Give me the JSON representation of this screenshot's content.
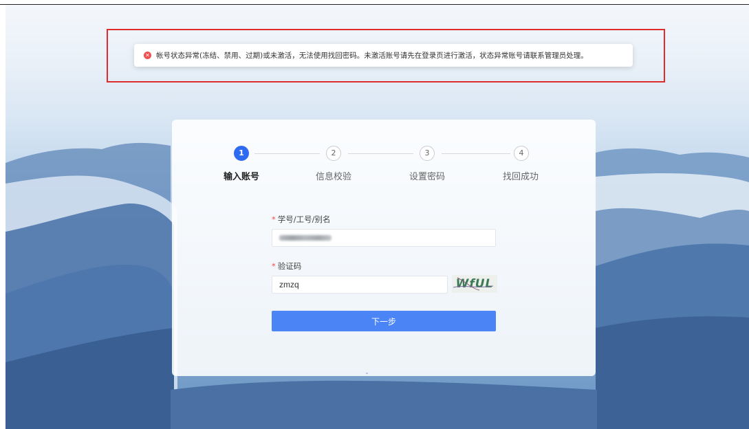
{
  "alert": {
    "icon": "error-circle-icon",
    "message": "帐号状态异常(冻结、禁用、过期)或未激活，无法使用找回密码。未激活账号请先在登录页进行激活，状态异常账号请联系管理员处理。"
  },
  "steps": [
    {
      "number": "1",
      "label": "输入账号",
      "active": true
    },
    {
      "number": "2",
      "label": "信息校验",
      "active": false
    },
    {
      "number": "3",
      "label": "设置密码",
      "active": false
    },
    {
      "number": "4",
      "label": "找回成功",
      "active": false
    }
  ],
  "form": {
    "account_label": "学号/工号/别名",
    "required_mark": "*",
    "captcha_label": "验证码",
    "captcha_value": "zmzq",
    "captcha_image_text": "WfUL",
    "next_label": "下一步"
  },
  "colors": {
    "accent": "#2f6bf0",
    "button": "#4a84f5",
    "error": "#f24e4e",
    "highlight_frame": "#e02b2b"
  }
}
